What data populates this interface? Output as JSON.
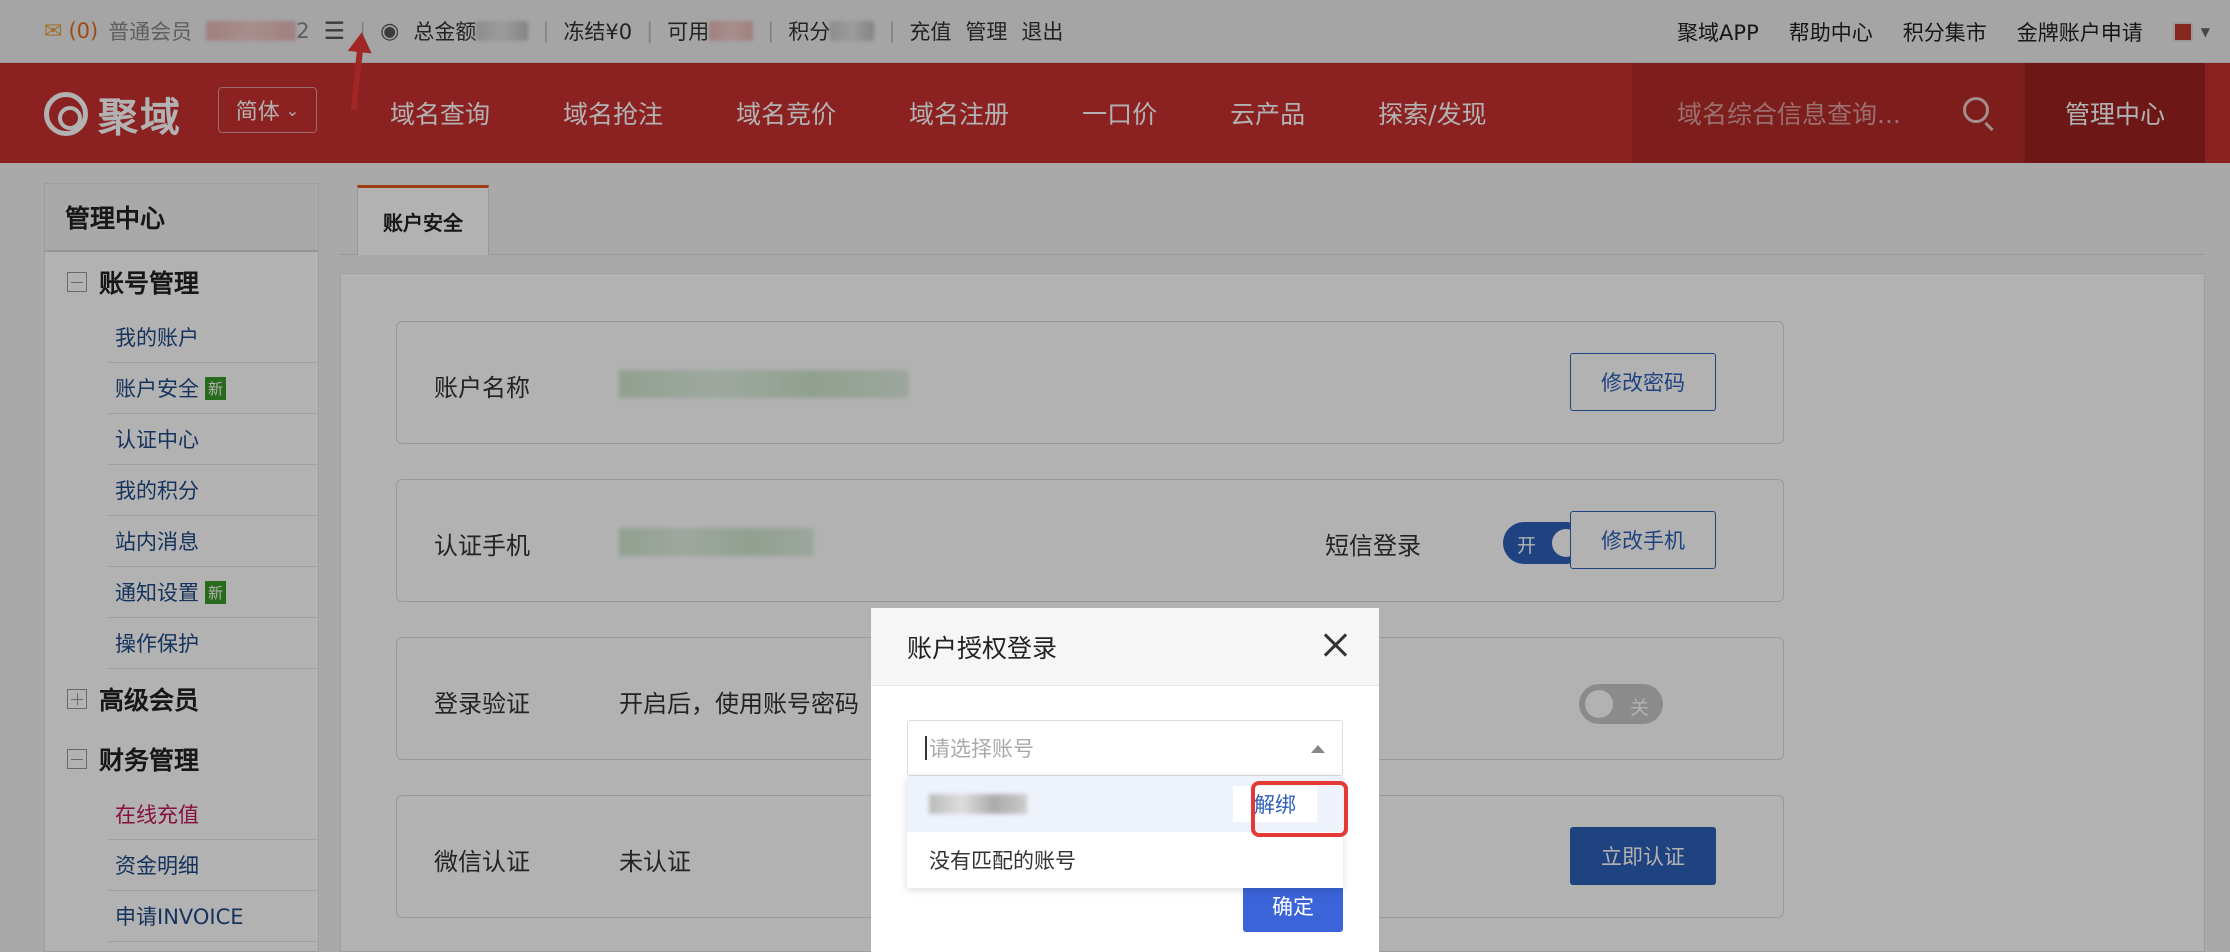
{
  "topbar": {
    "mail_count": "(0)",
    "member_level": "普通会员",
    "username_tail": "2",
    "total_label": "总金额",
    "frozen": "冻结¥0",
    "available_label": "可用",
    "points_label": "积分",
    "links": [
      "充值",
      "管理",
      "退出"
    ],
    "right_links": [
      "聚域APP",
      "帮助中心",
      "积分集市",
      "金牌账户申请"
    ]
  },
  "navbar": {
    "logo_text": "聚域",
    "lang": "简体",
    "menu": [
      "域名查询",
      "域名抢注",
      "域名竞价",
      "域名注册",
      "一口价",
      "云产品",
      "探索/发现"
    ],
    "search_placeholder": "域名综合信息查询...",
    "mgmt_center": "管理中心"
  },
  "sidebar": {
    "title": "管理中心",
    "groups": [
      {
        "label": "账号管理",
        "items": [
          "我的账户",
          "账户安全",
          "认证中心",
          "我的积分",
          "站内消息",
          "通知设置",
          "操作保护"
        ]
      },
      {
        "label": "高级会员"
      },
      {
        "label": "财务管理",
        "items": [
          "在线充值",
          "资金明细",
          "申请INVOICE"
        ]
      }
    ],
    "new_badge": "新"
  },
  "main": {
    "tab": "账户安全",
    "rows": {
      "account_name": {
        "label": "账户名称",
        "button": "修改密码"
      },
      "phone": {
        "label": "认证手机",
        "sms_label": "短信登录",
        "sms_toggle": "开",
        "button": "修改手机"
      },
      "login_verify": {
        "label": "登录验证",
        "desc": "开启后，使用账号密码",
        "toggle": "关"
      },
      "wechat": {
        "label": "微信认证",
        "value": "未认证",
        "button": "立即认证"
      }
    }
  },
  "modal": {
    "title": "账户授权登录",
    "select_placeholder": "请选择账号",
    "unbind": "解绑",
    "no_match": "没有匹配的账号",
    "confirm": "确定"
  }
}
